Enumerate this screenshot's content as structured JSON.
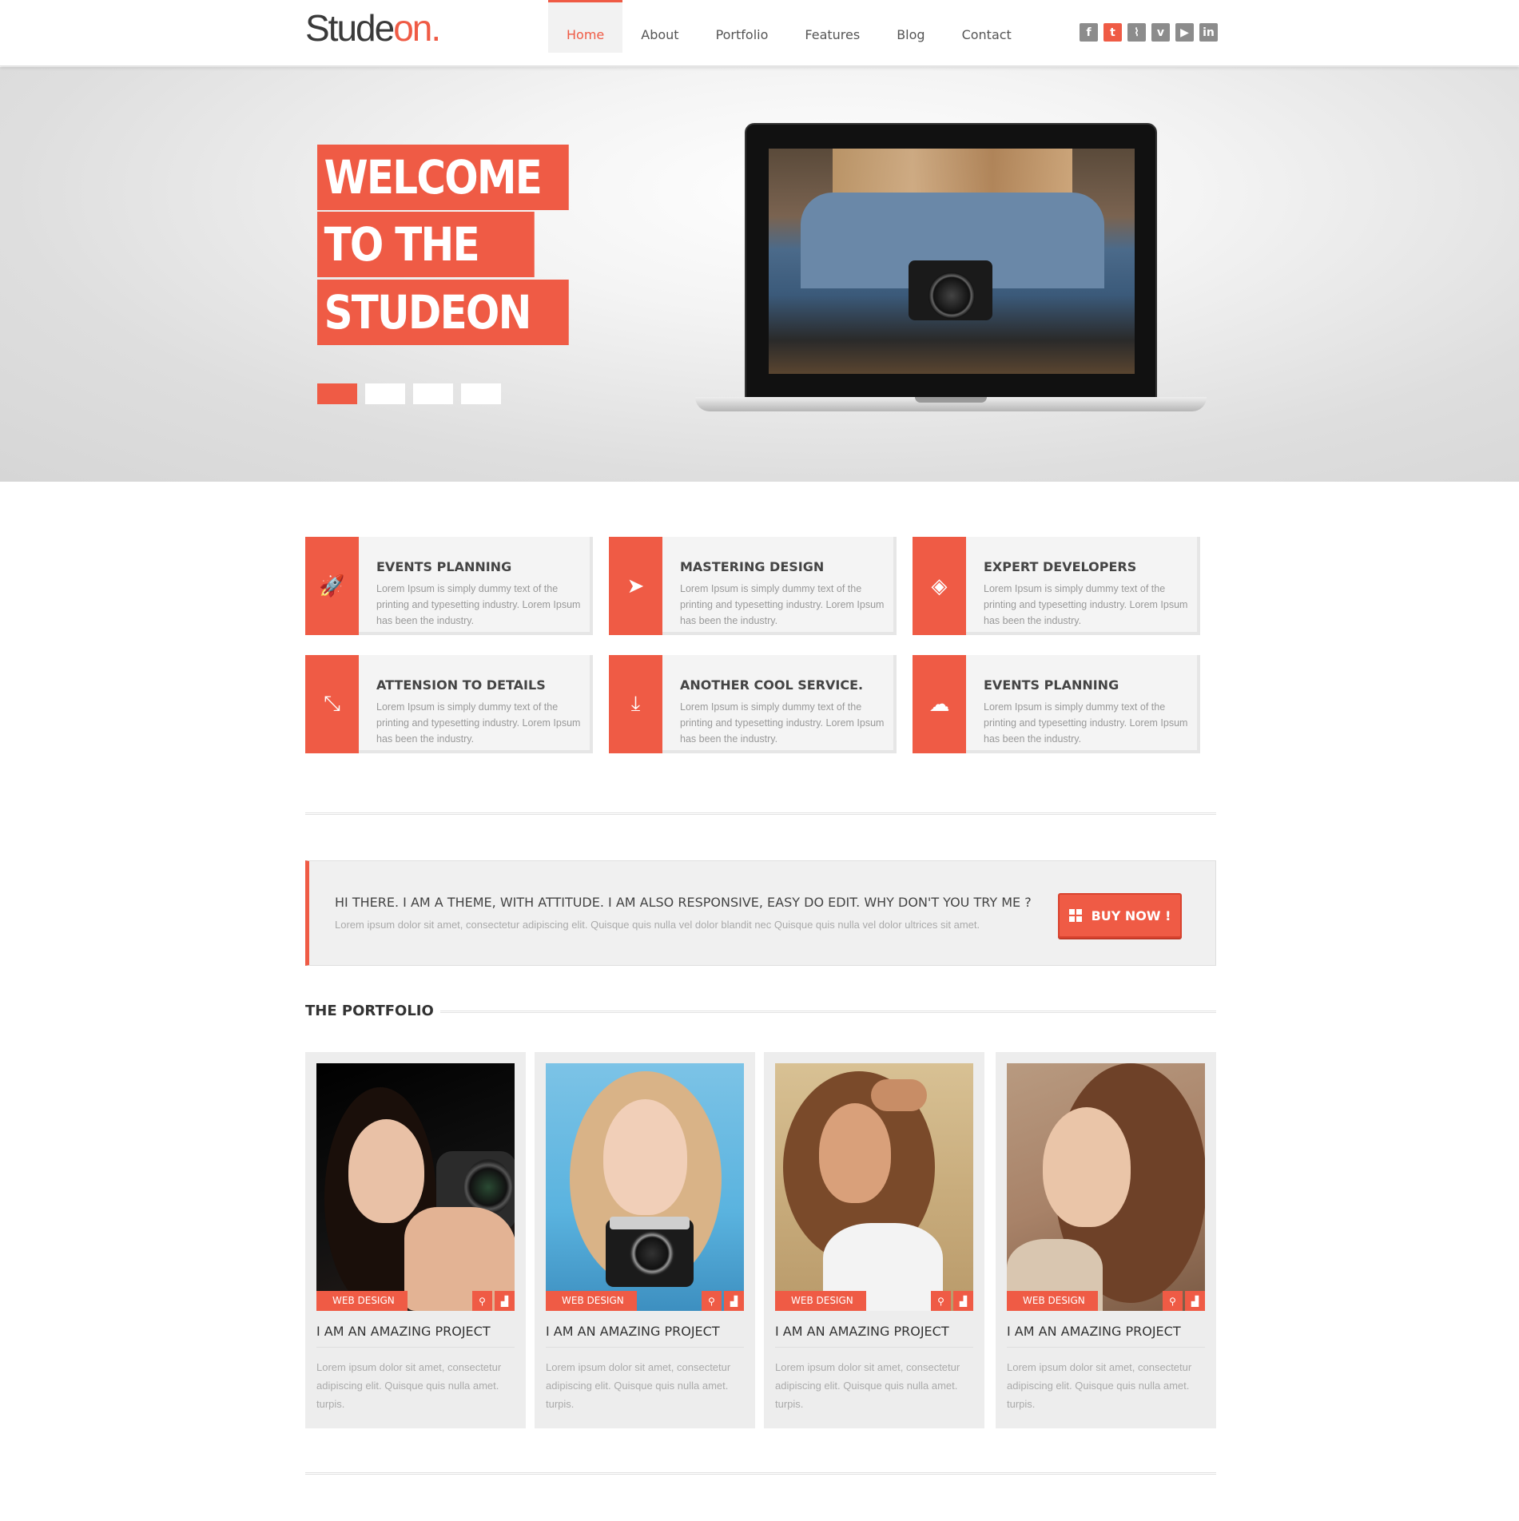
{
  "logo": {
    "main": "Stude",
    "accent": "on",
    "dot": "."
  },
  "nav": [
    {
      "label": "Home",
      "active": true
    },
    {
      "label": "About"
    },
    {
      "label": "Portfolio"
    },
    {
      "label": "Features"
    },
    {
      "label": "Blog"
    },
    {
      "label": "Contact"
    }
  ],
  "social": [
    {
      "icon": "facebook-icon",
      "glyph": "f"
    },
    {
      "icon": "twitter-icon",
      "glyph": "t"
    },
    {
      "icon": "rss-icon",
      "glyph": "⌇"
    },
    {
      "icon": "vimeo-icon",
      "glyph": "v"
    },
    {
      "icon": "youtube-icon",
      "glyph": "▶"
    },
    {
      "icon": "linkedin-icon",
      "glyph": "in"
    }
  ],
  "hero": {
    "lines": [
      "WELCOME",
      "TO THE",
      "STUDEON"
    ],
    "slides": 4,
    "active_slide": 1
  },
  "services": [
    {
      "title": "EVENTS PLANNING",
      "icon": "rocket-icon",
      "glyph": "🚀",
      "desc": "Lorem Ipsum is simply dummy text of the printing and typesetting industry. Lorem Ipsum has been the industry."
    },
    {
      "title": "MASTERING DESIGN",
      "icon": "paper-plane-icon",
      "glyph": "➤",
      "desc": "Lorem Ipsum is simply dummy text of the printing and typesetting industry. Lorem Ipsum has been the industry."
    },
    {
      "title": "EXPERT DEVELOPERS",
      "icon": "layers-icon",
      "glyph": "◈",
      "desc": "Lorem Ipsum is simply dummy text of the printing and typesetting industry. Lorem Ipsum has been the industry."
    },
    {
      "title": "ATTENSION TO DETAILS",
      "icon": "compress-icon",
      "glyph": "⤡",
      "desc": "Lorem Ipsum is simply dummy text of the printing and typesetting industry. Lorem Ipsum has been the industry."
    },
    {
      "title": "ANOTHER COOL SERVICE.",
      "icon": "download-icon",
      "glyph": "⤓",
      "desc": "Lorem Ipsum is simply dummy text of the printing and typesetting industry. Lorem Ipsum has been the industry."
    },
    {
      "title": "EVENTS PLANNING",
      "icon": "cloud-icon",
      "glyph": "☁",
      "desc": "Lorem Ipsum is simply dummy text of the printing and typesetting industry. Lorem Ipsum has been the industry."
    }
  ],
  "cta": {
    "title": "HI THERE. I AM A THEME, WITH ATTITUDE. I AM ALSO RESPONSIVE, EASY DO EDIT. WHY DON'T YOU TRY ME ?",
    "desc": "Lorem ipsum dolor sit amet, consectetur adipiscing elit. Quisque quis nulla vel dolor blandit nec Quisque quis nulla vel dolor ultrices sit amet.",
    "button": "BUY NOW !"
  },
  "portfolio": {
    "heading": "THE PORTFOLIO",
    "items": [
      {
        "tag": "WEB DESIGN",
        "title": "I AM AN AMAZING PROJECT",
        "desc": "Lorem ipsum dolor sit amet, consectetur adipiscing elit. Quisque quis nulla amet. turpis."
      },
      {
        "tag": "WEB DESIGN",
        "title": "I AM AN AMAZING PROJECT",
        "desc": "Lorem ipsum dolor sit amet, consectetur adipiscing elit. Quisque quis nulla amet. turpis."
      },
      {
        "tag": "WEB DESIGN",
        "title": "I AM AN AMAZING PROJECT",
        "desc": "Lorem ipsum dolor sit amet, consectetur adipiscing elit. Quisque quis nulla amet. turpis."
      },
      {
        "tag": "WEB DESIGN",
        "title": "I AM AN AMAZING PROJECT",
        "desc": "Lorem ipsum dolor sit amet, consectetur adipiscing elit. Quisque quis nulla amet. turpis."
      }
    ]
  },
  "colors": {
    "accent": "#ef5b45",
    "text": "#444444",
    "muted": "#aaaaaa"
  }
}
